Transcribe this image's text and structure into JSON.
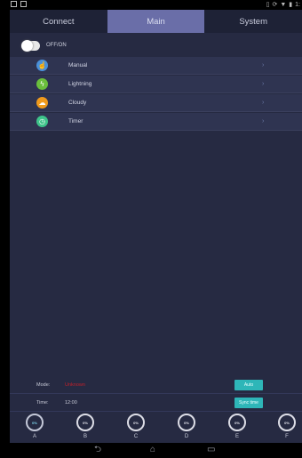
{
  "tabs": [
    {
      "label": "Connect"
    },
    {
      "label": "Main"
    },
    {
      "label": "System"
    }
  ],
  "power": {
    "label": "OFF/ON"
  },
  "menu": [
    {
      "label": "Manual",
      "icon": "hand-icon",
      "color": "#4a90d9"
    },
    {
      "label": "Lightning",
      "icon": "lightning-icon",
      "color": "#6abf3c"
    },
    {
      "label": "Cloudy",
      "icon": "cloud-icon",
      "color": "#f09a1c"
    },
    {
      "label": "Timer",
      "icon": "clock-icon",
      "color": "#3ec48a"
    }
  ],
  "status": {
    "mode_label": "Mode:",
    "mode_value": "Unknown",
    "time_label": "Time:",
    "time_value": "12:00",
    "auto_button": "Auto",
    "sync_button": "Sync time"
  },
  "channels": [
    {
      "name": "A",
      "value": "0%"
    },
    {
      "name": "B",
      "value": "0%"
    },
    {
      "name": "C",
      "value": "0%"
    },
    {
      "name": "D",
      "value": "0%"
    },
    {
      "name": "E",
      "value": "0%"
    },
    {
      "name": "F",
      "value": "0%"
    }
  ],
  "colors": {
    "background": "#262a42",
    "active_tab": "#6a6ea8",
    "accent_button": "#2eb6b8",
    "mode_value": "#c0202a"
  }
}
